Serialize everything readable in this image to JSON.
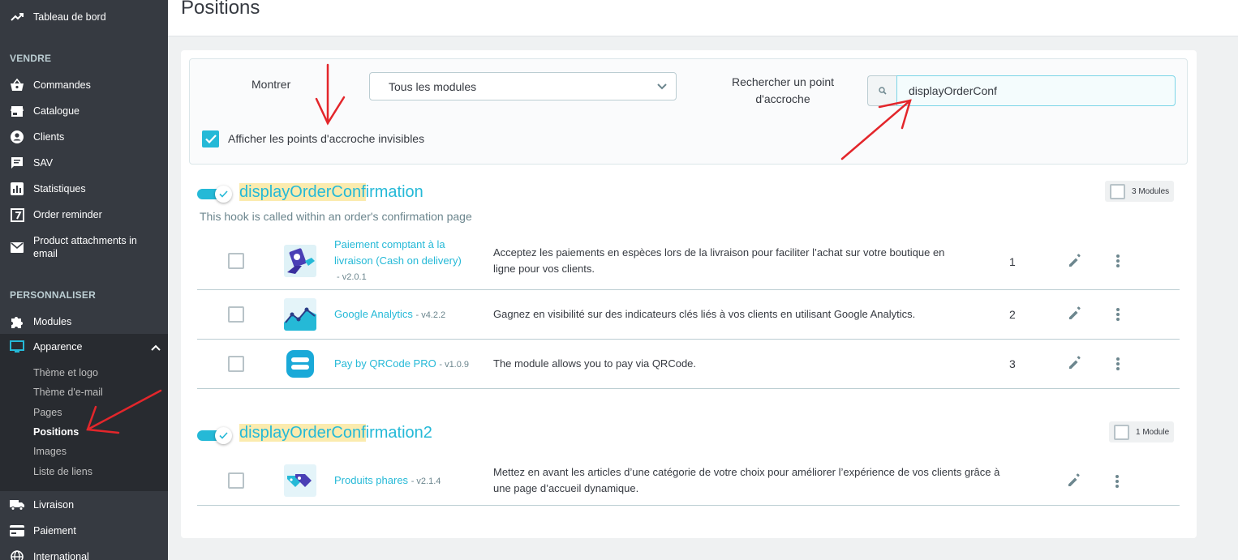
{
  "sidebar": {
    "items": [
      {
        "label": "Tableau de bord",
        "icon": "trending-up-icon"
      },
      {
        "label": "Commandes",
        "icon": "shopping-basket-icon"
      },
      {
        "label": "Catalogue",
        "icon": "store-icon"
      },
      {
        "label": "Clients",
        "icon": "account-circle-icon"
      },
      {
        "label": "SAV",
        "icon": "chat-icon"
      },
      {
        "label": "Statistiques",
        "icon": "bar-chart-icon"
      },
      {
        "label": "Order reminder",
        "icon": "calendar-seven-icon"
      },
      {
        "label": "Product attachments in email",
        "icon": "mail-icon"
      },
      {
        "label": "Modules",
        "icon": "puzzle-icon"
      },
      {
        "label": "Apparence",
        "icon": "desktop-icon"
      },
      {
        "label": "Livraison",
        "icon": "truck-icon"
      },
      {
        "label": "Paiement",
        "icon": "credit-card-icon"
      },
      {
        "label": "International",
        "icon": "globe-icon"
      }
    ],
    "sections": [
      "VENDRE",
      "PERSONNALISER"
    ],
    "sub_items": [
      "Thème et logo",
      "Thème d'e-mail",
      "Pages",
      "Positions",
      "Images",
      "Liste de liens"
    ]
  },
  "header": {
    "title": "Positions"
  },
  "filters": {
    "show_label": "Montrer",
    "select_value": "Tous les modules",
    "search_label_line1": "Rechercher un point",
    "search_label_line2": "d'accroche",
    "search_value": "displayOrderConf",
    "checkbox_label": "Afficher les points d'accroche invisibles",
    "checkbox_checked": true
  },
  "hooks": [
    {
      "name_highlight": "displayOrderConf",
      "name_rest": "irmation",
      "description": "This hook is called within an order's confirmation page",
      "module_count": "3 Modules",
      "modules": [
        {
          "name_line1": "Paiement comptant à la",
          "name_line2": "livraison (Cash on delivery)",
          "version": "- v2.0.1",
          "desc_line1": "Acceptez les paiements en espèces lors de la livraison pour faciliter l’achat sur votre boutique en",
          "desc_line2": "ligne pour vos clients.",
          "position": "1"
        },
        {
          "name": "Google Analytics",
          "version": "- v4.2.2",
          "description": "Gagnez en visibilité sur des indicateurs clés liés à vos clients en utilisant Google Analytics.",
          "position": "2"
        },
        {
          "name": "Pay by QRCode PRO",
          "version": "- v1.0.9",
          "description": "The module allows you to pay via QRCode.",
          "position": "3"
        }
      ]
    },
    {
      "name_highlight": "displayOrderConf",
      "name_rest": "irmation2",
      "module_count": "1 Module",
      "modules": [
        {
          "name": "Produits phares",
          "version": "- v2.1.4",
          "desc_line1": "Mettez en avant les articles d’une catégorie de votre choix pour améliorer l’expérience de vos clients grâce à",
          "desc_line2": "une page d’accueil dynamique."
        }
      ]
    }
  ],
  "colors": {
    "accent": "#25b9d7",
    "sidebar": "#363a41",
    "highlight": "#fbebae",
    "annotation": "#e3262b"
  }
}
